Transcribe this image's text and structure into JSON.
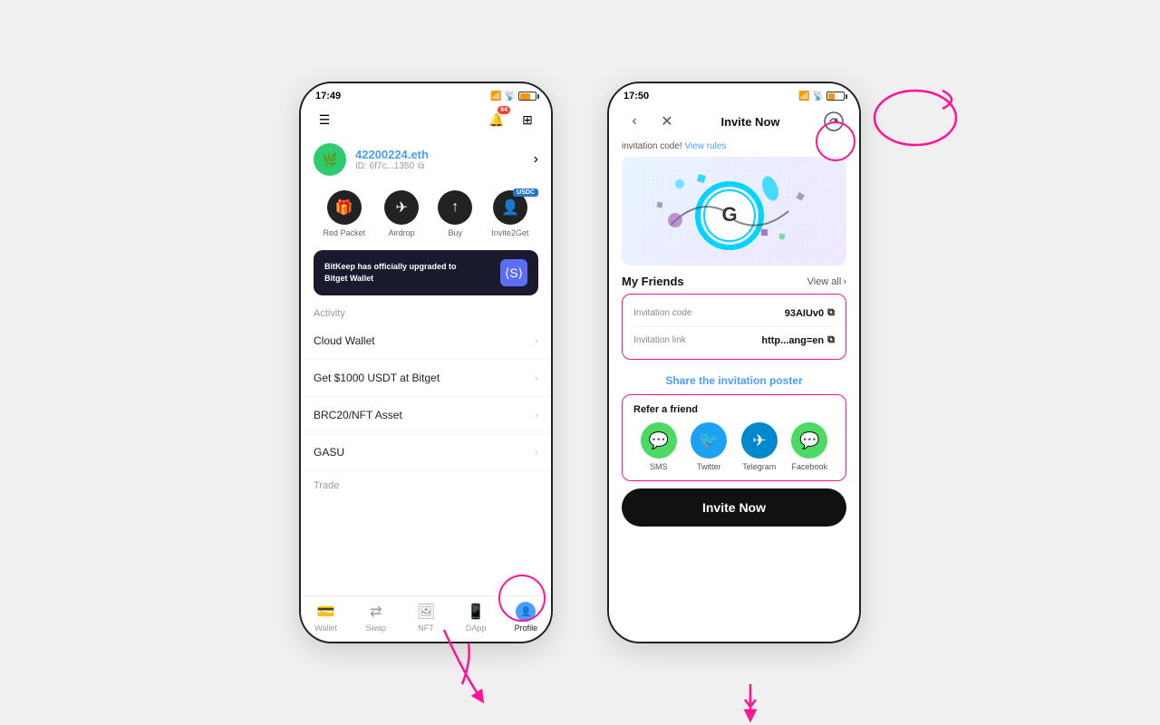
{
  "bg_color": "#f0f0f0",
  "phone1": {
    "status_time": "17:49",
    "account_name": "42200224.eth",
    "account_id": "ID: 6f7c...1350",
    "actions": [
      {
        "label": "Red Packet",
        "icon": "🎁"
      },
      {
        "label": "Airdrop",
        "icon": "✈️"
      },
      {
        "label": "Buy",
        "icon": "💰"
      },
      {
        "label": "Invite2Get",
        "icon": "👤"
      }
    ],
    "usdc_badge": "USDC",
    "banner_text": "BitKeep has officially upgraded to Bitget Wallet",
    "activity_label": "Activity",
    "list_items": [
      "Cloud Wallet",
      "Get $1000 USDT at Bitget",
      "BRC20/NFT Asset",
      "GASU"
    ],
    "trade_label": "Trade",
    "nav_items": [
      {
        "label": "Wallet",
        "icon": "💳"
      },
      {
        "label": "Swap",
        "icon": "🔄"
      },
      {
        "label": "NFT",
        "icon": "🖼️"
      },
      {
        "label": "DApp",
        "icon": "📱"
      },
      {
        "label": "Profile",
        "active": true
      }
    ]
  },
  "phone2": {
    "status_time": "17:50",
    "title": "Invite Now",
    "invite_text": "invitation code!",
    "view_rules": "View rules",
    "friends_title": "My Friends",
    "view_all": "View all",
    "invitation_code_label": "Invitation code",
    "invitation_code_value": "93AIUv0",
    "invitation_link_label": "Invitation link",
    "invitation_link_value": "http...ang=en",
    "share_poster": "Share the invitation poster",
    "refer_title": "Refer a friend",
    "social_items": [
      {
        "label": "SMS",
        "icon": "💬",
        "color": "sms"
      },
      {
        "label": "Twitter",
        "icon": "🐦",
        "color": "twitter"
      },
      {
        "label": "Telegram",
        "icon": "✈️",
        "color": "telegram"
      },
      {
        "label": "Facebook",
        "icon": "💬",
        "color": "facebook"
      }
    ],
    "invite_now_btn": "Invite Now"
  }
}
